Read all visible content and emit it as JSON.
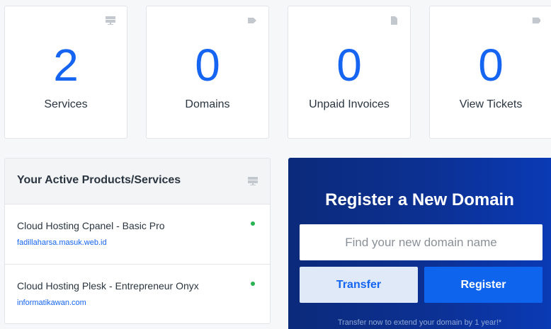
{
  "stats": [
    {
      "value": "2",
      "label": "Services",
      "icon": "server-icon"
    },
    {
      "value": "0",
      "label": "Domains",
      "icon": "tag-icon"
    },
    {
      "value": "0",
      "label": "Unpaid Invoices",
      "icon": "file-icon"
    },
    {
      "value": "0",
      "label": "View Tickets",
      "icon": "ticket-icon"
    }
  ],
  "products": {
    "title": "Your Active Products/Services",
    "icon": "server-icon",
    "items": [
      {
        "name": "Cloud Hosting Cpanel - Basic Pro",
        "domain": "fadillaharsa.masuk.web.id",
        "status": "active"
      },
      {
        "name": "Cloud Hosting Plesk - Entrepreneur Onyx",
        "domain": "informatikawan.com",
        "status": "active"
      }
    ]
  },
  "domain_search": {
    "title": "Register a New Domain",
    "placeholder": "Find your new domain name",
    "transfer_label": "Transfer",
    "register_label": "Register",
    "note": "Transfer now to extend your domain by 1 year!*"
  },
  "colors": {
    "accent": "#1565f2",
    "status_active": "#2ab353",
    "domain_bg": "#0c3194"
  }
}
